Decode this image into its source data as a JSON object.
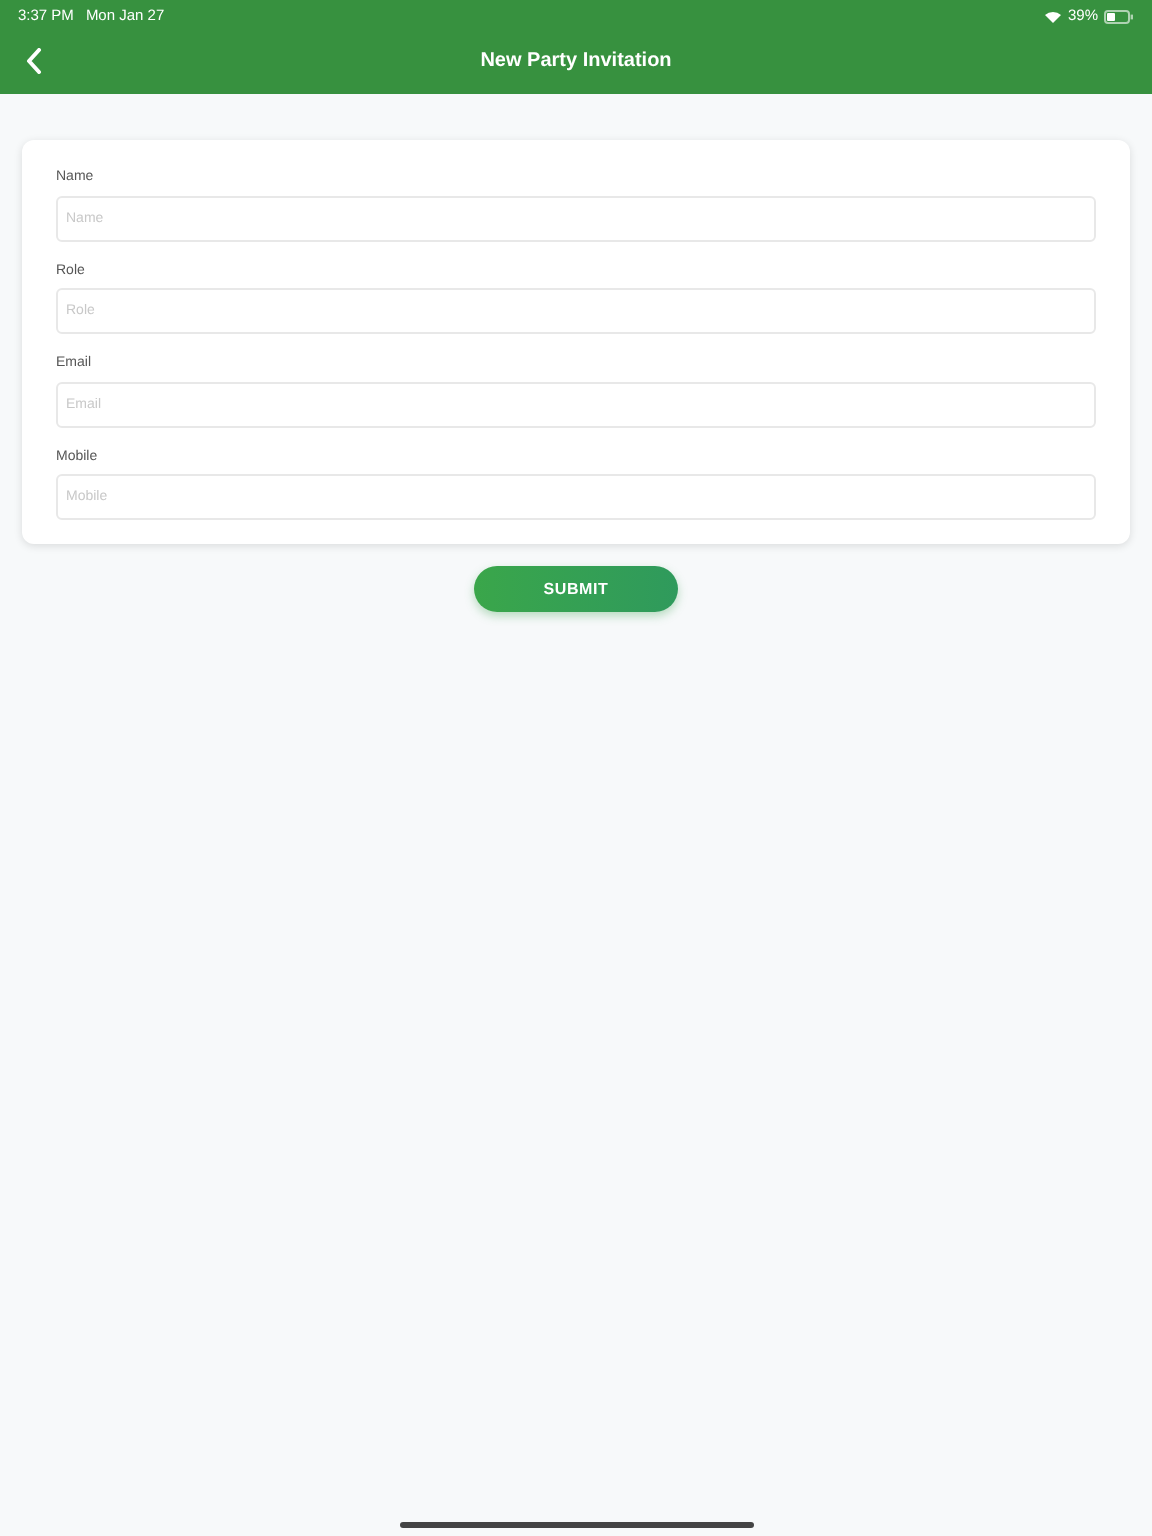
{
  "status_bar": {
    "time": "3:37 PM",
    "date": "Mon Jan 27",
    "battery": "39%"
  },
  "nav_bar": {
    "title": "New Party Invitation"
  },
  "form": {
    "fields": [
      {
        "label": "Name",
        "placeholder": "Name"
      },
      {
        "label": "Role",
        "placeholder": "Role"
      },
      {
        "label": "Email",
        "placeholder": "Email"
      },
      {
        "label": "Mobile",
        "placeholder": "Mobile"
      }
    ]
  },
  "submit_button": "SUBMIT"
}
